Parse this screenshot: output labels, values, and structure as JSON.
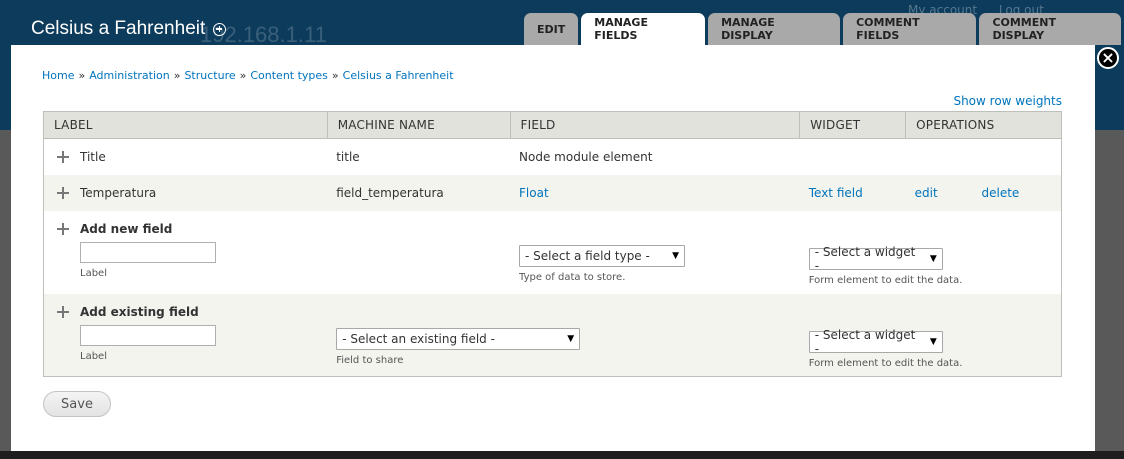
{
  "background": {
    "ip_text": "192.168.1.11",
    "links": [
      "My account",
      "Log out"
    ]
  },
  "overlay": {
    "title": "Celsius a Fahrenheit",
    "tabs": [
      {
        "label": "EDIT",
        "active": false
      },
      {
        "label": "MANAGE FIELDS",
        "active": true
      },
      {
        "label": "MANAGE DISPLAY",
        "active": false
      },
      {
        "label": "COMMENT FIELDS",
        "active": false
      },
      {
        "label": "COMMENT DISPLAY",
        "active": false
      }
    ],
    "close_label": "×"
  },
  "breadcrumb": [
    "Home",
    "Administration",
    "Structure",
    "Content types",
    "Celsius a Fahrenheit"
  ],
  "breadcrumb_sep": "»",
  "show_row_weights": "Show row weights",
  "table": {
    "headers": [
      "LABEL",
      "MACHINE NAME",
      "FIELD",
      "WIDGET",
      "OPERATIONS"
    ],
    "rows": [
      {
        "label": "Title",
        "machine_name": "title",
        "field": "Node module element",
        "widget": "",
        "edit": "",
        "delete": ""
      },
      {
        "label": "Temperatura",
        "machine_name": "field_temperatura",
        "field": "Float",
        "widget": "Text field",
        "edit": "edit",
        "delete": "delete"
      }
    ],
    "add_new": {
      "title": "Add new field",
      "label_help": "Label",
      "label_value": "",
      "field_type_select": "- Select a field type -",
      "field_type_help": "Type of data to store.",
      "widget_select": "- Select a widget -",
      "widget_help": "Form element to edit the data."
    },
    "add_existing": {
      "title": "Add existing field",
      "label_help": "Label",
      "label_value": "",
      "existing_select": "- Select an existing field -",
      "existing_help": "Field to share",
      "widget_select": "- Select a widget -",
      "widget_help": "Form element to edit the data."
    }
  },
  "save_label": "Save",
  "colors": {
    "link": "#0074bd",
    "header_bg": "#0d3b5b",
    "table_header_bg": "#e1e2dc",
    "tab_bg": "#a9a9a9"
  }
}
